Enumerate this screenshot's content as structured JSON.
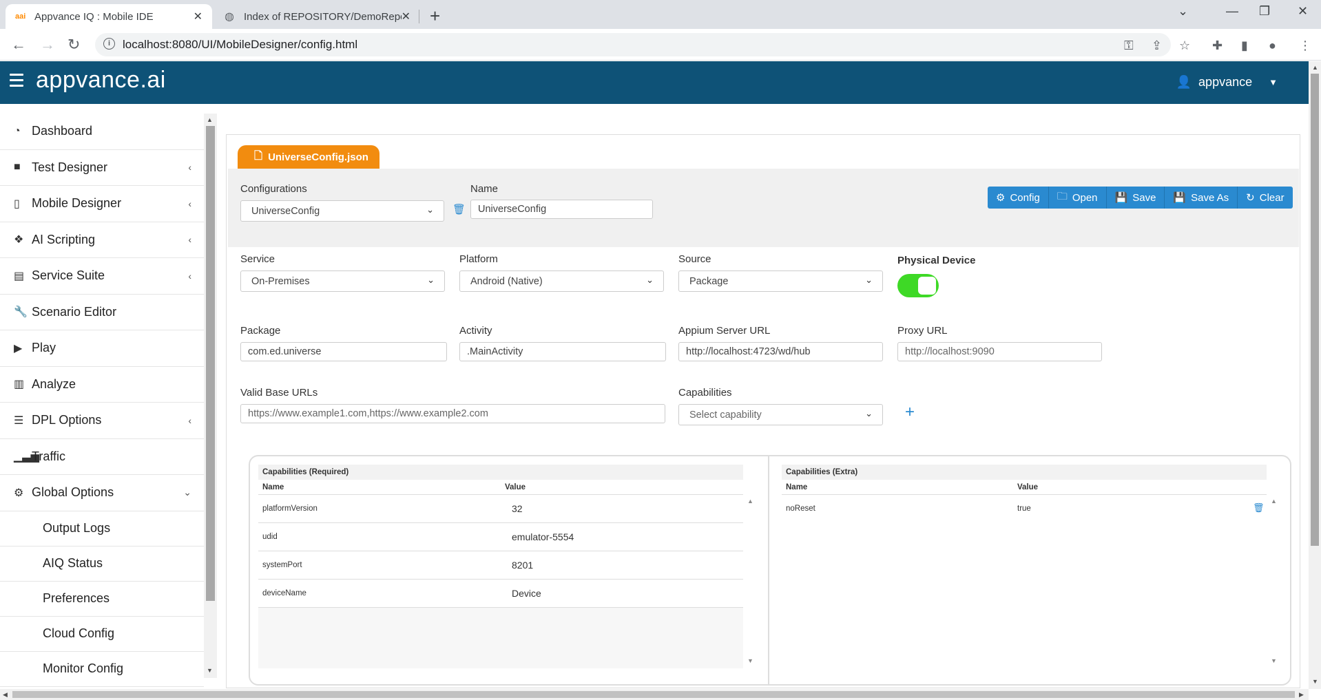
{
  "browser": {
    "tabs": [
      {
        "label": "Appvance IQ : Mobile IDE",
        "favicon": "aai"
      },
      {
        "label": "Index of REPOSITORY/DemoRepo"
      }
    ],
    "url": "localhost:8080/UI/MobileDesigner/config.html"
  },
  "header": {
    "brand": "appvance.ai",
    "user": "appvance"
  },
  "sidebar": {
    "items": [
      {
        "label": "Dashboard",
        "icon": "dashboard-icon"
      },
      {
        "label": "Test Designer",
        "icon": "video-camera-icon"
      },
      {
        "label": "Mobile Designer",
        "icon": "mobile-icon"
      },
      {
        "label": "AI Scripting",
        "icon": "cubes-icon"
      },
      {
        "label": "Service Suite",
        "icon": "briefcase-icon"
      },
      {
        "label": "Scenario Editor",
        "icon": "wrench-icon"
      },
      {
        "label": "Play",
        "icon": "play-icon"
      },
      {
        "label": "Analyze",
        "icon": "bar-chart-icon"
      },
      {
        "label": "DPL Options",
        "icon": "list-icon"
      },
      {
        "label": "Traffic",
        "icon": "signal-icon"
      },
      {
        "label": "Global Options",
        "icon": "gears-icon"
      }
    ],
    "subitems": [
      "Output Logs",
      "AIQ Status",
      "Preferences",
      "Cloud Config",
      "Monitor Config"
    ]
  },
  "config": {
    "file_tab": "UniverseConfig.json",
    "configurations_label": "Configurations",
    "configurations_value": "UniverseConfig",
    "name_label": "Name",
    "name_value": "UniverseConfig",
    "buttons": {
      "config": "Config",
      "open": "Open",
      "save": "Save",
      "save_as": "Save As",
      "clear": "Clear"
    },
    "service_label": "Service",
    "service_value": "On-Premises",
    "platform_label": "Platform",
    "platform_value": "Android (Native)",
    "source_label": "Source",
    "source_value": "Package",
    "physical_device_label": "Physical Device",
    "physical_device_on": true,
    "package_label": "Package",
    "package_value": "com.ed.universe",
    "activity_label": "Activity",
    "activity_value": ".MainActivity",
    "appium_label": "Appium Server URL",
    "appium_value": "http://localhost:4723/wd/hub",
    "proxy_label": "Proxy URL",
    "proxy_placeholder": "http://localhost:9090",
    "valid_urls_label": "Valid Base URLs",
    "valid_urls_placeholder": "https://www.example1.com,https://www.example2.com",
    "capabilities_label": "Capabilities",
    "capabilities_placeholder": "Select capability"
  },
  "caps_required": {
    "title": "Capabilities (Required)",
    "col_name": "Name",
    "col_value": "Value",
    "rows": [
      {
        "name": "platformVersion",
        "value": "32"
      },
      {
        "name": "udid",
        "value": "emulator-5554"
      },
      {
        "name": "systemPort",
        "value": "8201"
      },
      {
        "name": "deviceName",
        "value": "Device"
      }
    ]
  },
  "caps_extra": {
    "title": "Capabilities (Extra)",
    "col_name": "Name",
    "col_value": "Value",
    "rows": [
      {
        "name": "noReset",
        "value": "true"
      }
    ]
  },
  "colors": {
    "header": "#0e5277",
    "accent": "#2a8ad0",
    "file_tab": "#f28c0f",
    "toggle_on": "#3ed926"
  }
}
